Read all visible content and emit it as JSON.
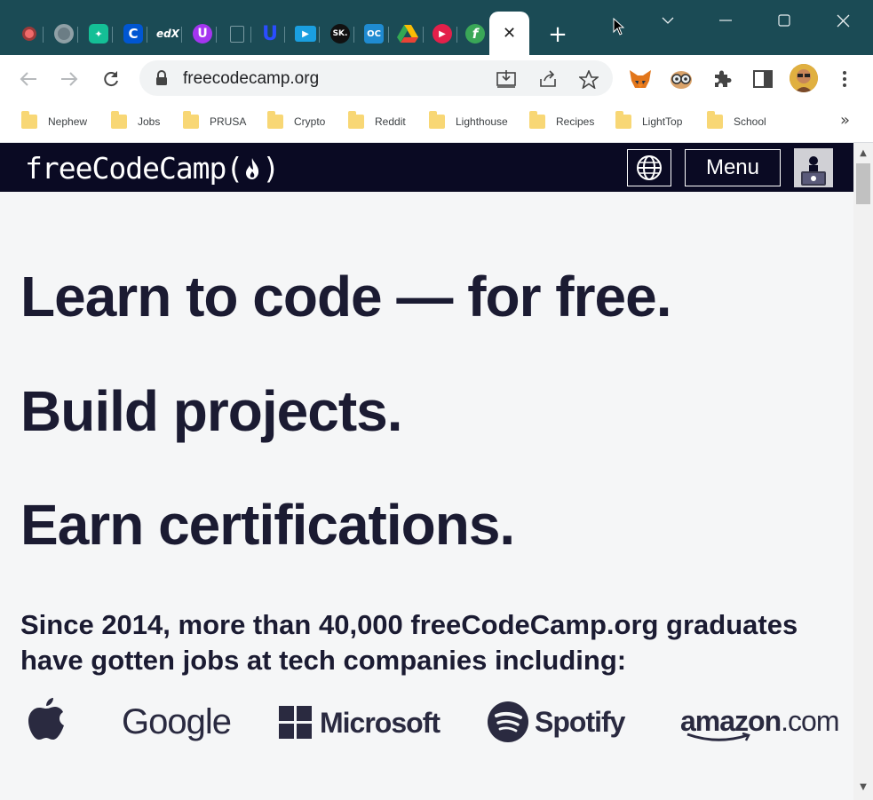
{
  "browser": {
    "tabs": [
      {
        "icon": "record-icon",
        "color": "#f06b6b"
      },
      {
        "icon": "chrome-icon",
        "color": "#6b7d85"
      },
      {
        "icon": "khan-academy-icon",
        "color": "#14bf96"
      },
      {
        "icon": "coursera-icon",
        "color": "#0056d2"
      },
      {
        "icon": "edx-icon",
        "color": "#1b4b55",
        "text": "edX"
      },
      {
        "icon": "udemy-icon",
        "color": "#a435f0",
        "text": "U"
      },
      {
        "icon": "document-icon",
        "color": "#5f8790"
      },
      {
        "icon": "udacity-icon",
        "color": "#2015ff",
        "text": "U"
      },
      {
        "icon": "video-icon",
        "color": "#1a9fe0"
      },
      {
        "icon": "skillshare-icon",
        "color": "#111111",
        "text": "SK."
      },
      {
        "icon": "openclassrooms-icon",
        "color": "#1f8bd1",
        "text": "OC"
      },
      {
        "icon": "google-drive-icon",
        "color": "#34a853"
      },
      {
        "icon": "youtube-play-icon",
        "color": "#e3204a"
      },
      {
        "icon": "freecodecamp-tab-icon",
        "color": "#3aa757",
        "text": "f"
      }
    ],
    "active_tab_close": "✕",
    "new_tab": "+",
    "url": "freecodecamp.org",
    "bookmarks": [
      "Nephew",
      "Jobs",
      "PRUSA",
      "Crypto",
      "Reddit",
      "Lighthouse",
      "Recipes",
      "LightTop",
      "School"
    ],
    "bookmarks_more": "»"
  },
  "site": {
    "logo_text": "freeCodeCamp(",
    "logo_close": ")",
    "menu_label": "Menu",
    "headlines": [
      "Learn to code — for free.",
      "Build projects.",
      "Earn certifications."
    ],
    "since_text": "Since 2014, more than 40,000 freeCodeCamp.org graduates have gotten jobs at tech companies including:",
    "companies": {
      "google": "Google",
      "microsoft": "Microsoft",
      "spotify": "Spotify",
      "amazon": "amazon",
      "amazon_suffix": ".com"
    },
    "colors": {
      "nav_bg": "#0a0a23",
      "page_bg": "#f5f6f7",
      "text": "#1b1b32"
    }
  }
}
